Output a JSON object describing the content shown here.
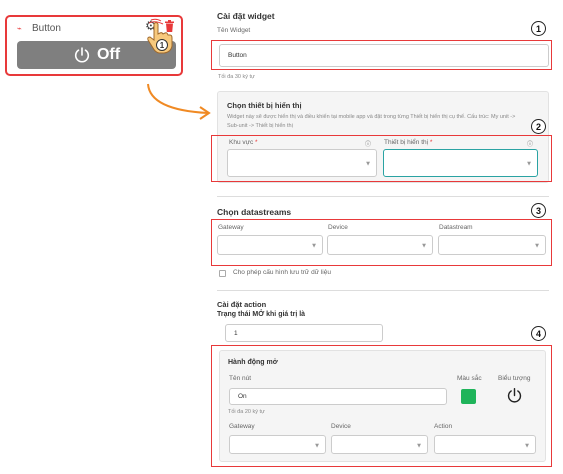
{
  "widget": {
    "name": "Button",
    "state": "Off",
    "hand_badge": "1",
    "colors": {
      "border": "#e8393a",
      "button_bg": "#7f7f7f"
    }
  },
  "settings": {
    "title": "Cài đặt widget",
    "name_label": "Tên Widget",
    "name_value": "Button",
    "name_hint": "Tối đa 30 ký tự"
  },
  "display_device": {
    "title": "Chọn thiết bị hiển thị",
    "description_line1": "Widget này sẽ được hiển thị và điều khiển tại mobile app và đặt trong từng Thiết bị hiển thị cụ thể. Cấu trúc: My unit ->",
    "description_line2": "Sub-unit -> Thiết bị hiển thị",
    "area_label": "Khu vực",
    "device_label": "Thiết bị hiển thị",
    "required_mark": "*",
    "info_icon": "ⓘ"
  },
  "datastreams": {
    "title": "Chọn datastreams",
    "gateway_label": "Gateway",
    "device_label": "Device",
    "datastream_label": "Datastream",
    "storage_checkbox_label": "Cho phép cấu hình lưu trữ dữ liệu"
  },
  "action": {
    "title": "Cài đặt action",
    "on_state_label": "Trạng thái MỞ khi giá trị là",
    "on_state_value": "1",
    "panel_title": "Hành động mở",
    "name_label": "Tên nút",
    "name_value": "On",
    "name_hint": "Tối đa 20 ký tự",
    "color_label": "Màu sắc",
    "icon_label": "Biểu tượng",
    "gateway_label": "Gateway",
    "device_label": "Device",
    "action_label": "Action",
    "color_value": "#1fb45a"
  },
  "badges": [
    "1",
    "2",
    "3",
    "4"
  ]
}
